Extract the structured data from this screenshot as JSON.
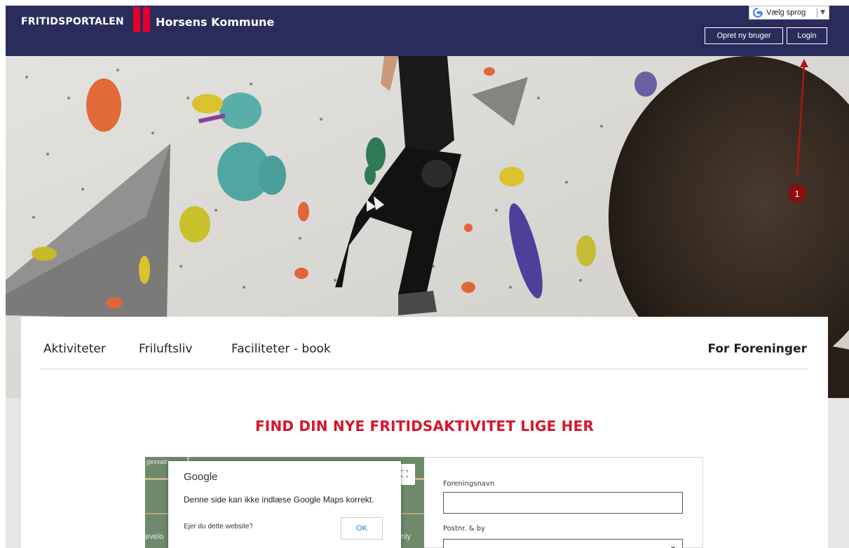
{
  "header": {
    "brand": "FRITIDSPORTALEN",
    "kommune": "Horsens Kommune",
    "language_label": "Vælg sprog",
    "signup_label": "Opret ny bruger",
    "login_label": "Login"
  },
  "annotation": {
    "badge": "1"
  },
  "nav": {
    "items": [
      "Aktiviteter",
      "Friluftsliv",
      "Faciliteter - book",
      "For Foreninger"
    ]
  },
  "main": {
    "headline": "FIND DIN NYE FRITIDSAKTIVITET LIGE HER"
  },
  "map_error": {
    "title": "Google",
    "message": "Denne side kan ikke indlæse Google Maps korrekt.",
    "owner_question": "Ejer du dette website?",
    "ok_label": "OK"
  },
  "map_labels": {
    "top_left": "gesvad",
    "bottom_left": "evelo",
    "bottom_right": "nly"
  },
  "search_form": {
    "association_label": "Foreningsnavn",
    "association_value": "",
    "zip_label": "Postnr. & by"
  },
  "colors": {
    "header_bg": "#2a2d5c",
    "accent_red": "#e4002b",
    "headline_red": "#d8152d",
    "annotation_red": "#8b0d0d"
  }
}
